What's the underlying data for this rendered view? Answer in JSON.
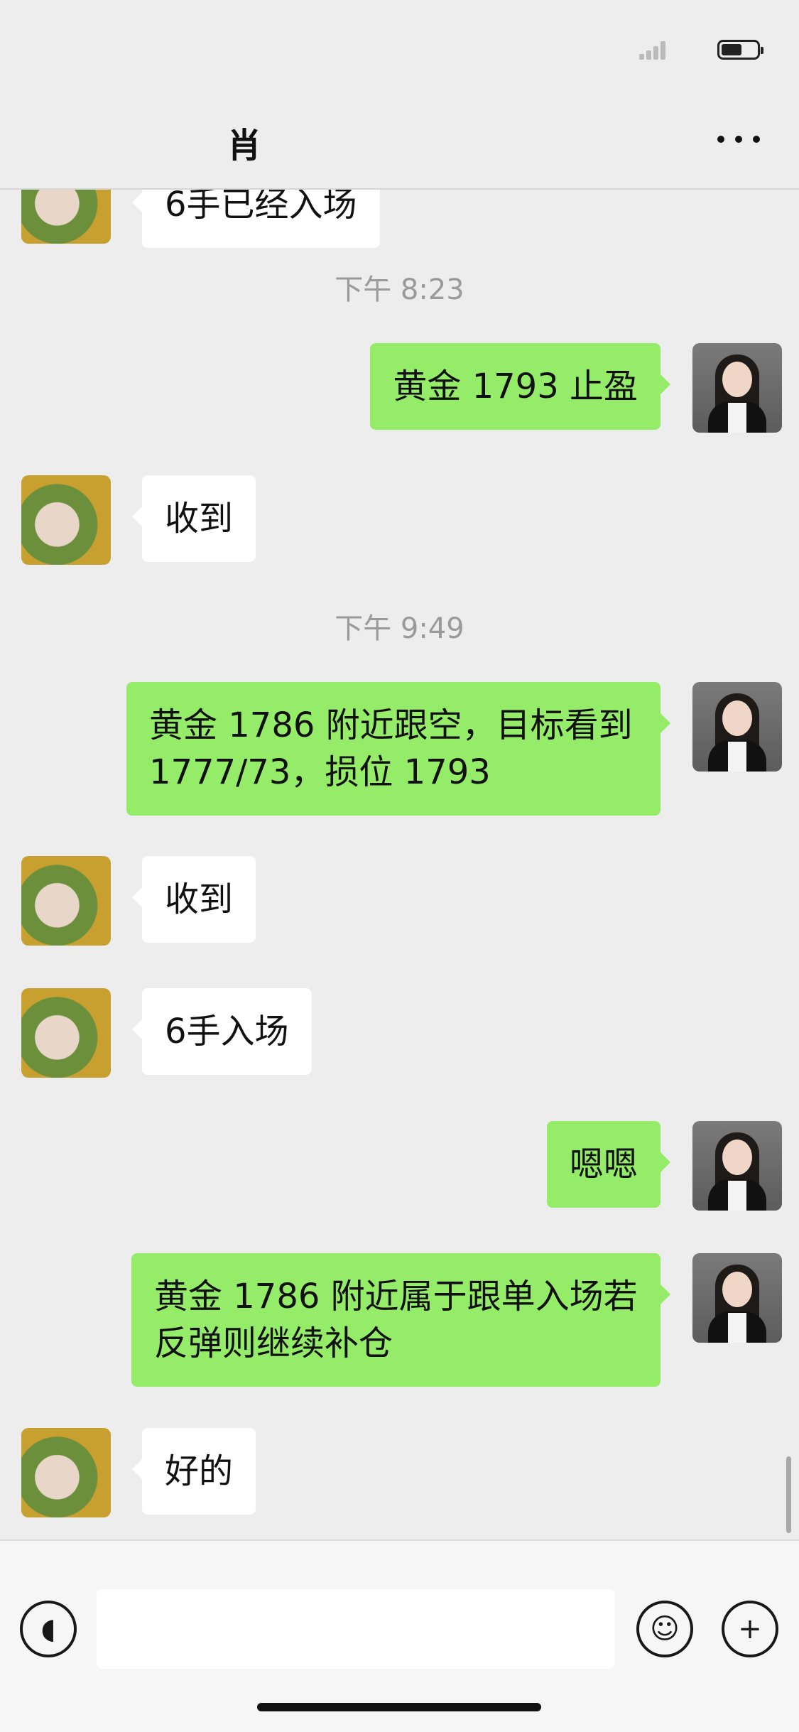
{
  "nav": {
    "title": "肖",
    "more_icon": "more-dots-icon"
  },
  "status": {
    "battery_icon": "battery-icon",
    "signal_icon": "signal-icon"
  },
  "messages": [
    {
      "type": "partial",
      "side": "left",
      "text": "6手已经入场"
    },
    {
      "type": "time",
      "text": "下午 8:23"
    },
    {
      "type": "msg",
      "side": "right",
      "text": "黄金 1793 止盈"
    },
    {
      "type": "msg",
      "side": "left",
      "text": "收到"
    },
    {
      "type": "time",
      "text": "下午 9:49"
    },
    {
      "type": "msg",
      "side": "right",
      "text": "黄金 1786 附近跟空，目标看到 1777/73，损位 1793"
    },
    {
      "type": "msg",
      "side": "left",
      "text": "收到"
    },
    {
      "type": "msg",
      "side": "left",
      "text": "6手入场"
    },
    {
      "type": "msg",
      "side": "right",
      "text": "嗯嗯"
    },
    {
      "type": "msg",
      "side": "right",
      "text": "黄金 1786 附近属于跟单入场若反弹则继续补仓"
    },
    {
      "type": "msg",
      "side": "left",
      "text": "好的"
    }
  ],
  "input_bar": {
    "voice_icon": "voice-icon",
    "emoji_icon": "emoji-icon",
    "plus_icon": "plus-icon",
    "input_value": ""
  },
  "colors": {
    "background": "#ededed",
    "sent_bubble": "#95ec69",
    "received_bubble": "#ffffff"
  }
}
